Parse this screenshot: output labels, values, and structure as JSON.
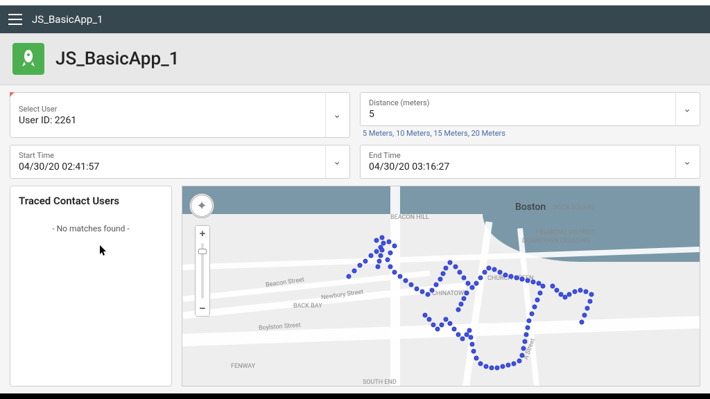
{
  "appbar": {
    "title": "JS_BasicApp_1"
  },
  "header": {
    "title": "JS_BasicApp_1"
  },
  "fields": {
    "selectUser": {
      "label": "Select User",
      "value": "User ID: 2261"
    },
    "distance": {
      "label": "Distance (meters)",
      "value": "5",
      "helper": "5 Meters, 10 Meters, 15 Meters, 20 Meters"
    },
    "startTime": {
      "label": "Start Time",
      "value": "04/30/20 02:41:57"
    },
    "endTime": {
      "label": "End Time",
      "value": "04/30/20 03:16:27"
    }
  },
  "panel": {
    "title": "Traced Contact Users",
    "empty": "- No matches found -"
  },
  "map": {
    "labels": {
      "boston": "Boston",
      "beaconHill": "BEACON HILL",
      "dockSquare": "DOCK SQUARE",
      "financial": "FINANCIAL DISTRICT",
      "downtown": "DOWNTOWN CROSSING",
      "chinatown": "CHINATOWN",
      "church": "CHURCH GREEN",
      "backBay": "BACK BAY",
      "fenway": "FENWAY",
      "southEnd": "SOUTH END",
      "beaconSt": "Beacon Street",
      "newburySt": "Newbury Street",
      "boylstonSt": "Boylston Street",
      "aStreet": "A Street"
    }
  }
}
